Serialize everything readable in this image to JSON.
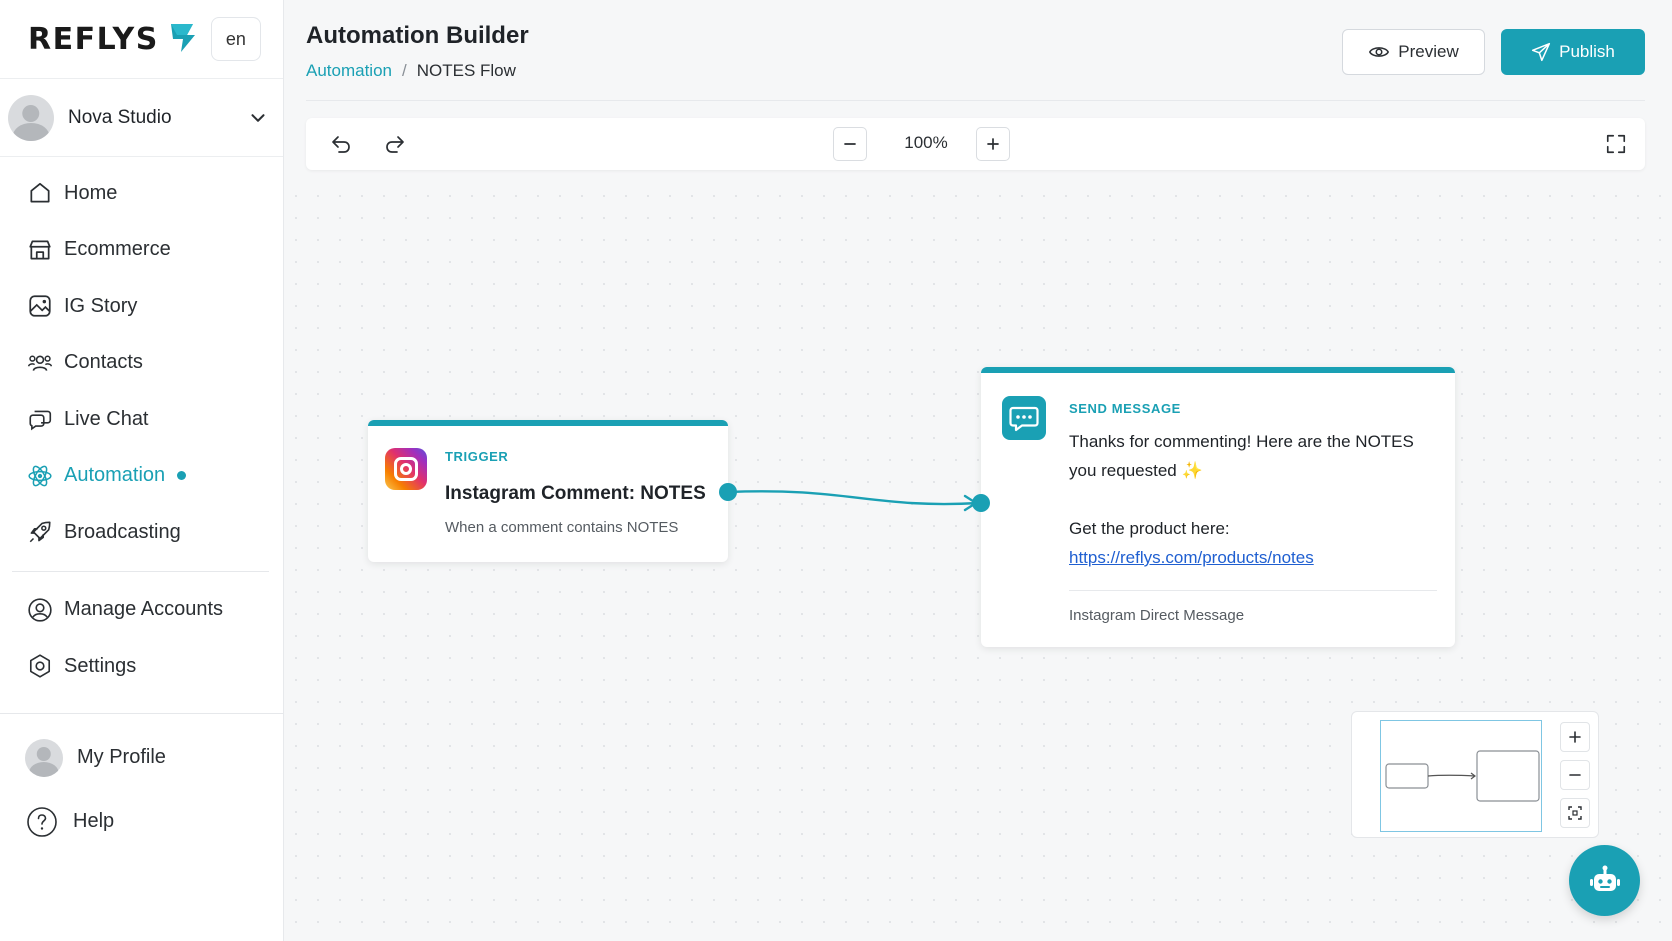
{
  "brand": {
    "logo_text": "REFLYS",
    "lang": "en"
  },
  "workspace": {
    "name": "Nova Studio"
  },
  "nav": {
    "items": [
      {
        "label": "Home",
        "icon": "home-icon"
      },
      {
        "label": "Ecommerce",
        "icon": "store-icon"
      },
      {
        "label": "IG Story",
        "icon": "story-icon"
      },
      {
        "label": "Contacts",
        "icon": "contacts-icon"
      },
      {
        "label": "Live Chat",
        "icon": "chat-icon"
      },
      {
        "label": "Automation",
        "icon": "automation-icon",
        "active": true
      },
      {
        "label": "Broadcasting",
        "icon": "rocket-icon"
      }
    ],
    "secondary": [
      {
        "label": "Manage Accounts",
        "icon": "user-circle-icon"
      },
      {
        "label": "Settings",
        "icon": "settings-icon"
      }
    ],
    "profile": "My Profile",
    "help": "Help"
  },
  "header": {
    "title": "Automation Builder",
    "breadcrumb_parent": "Automation",
    "breadcrumb_sep": "/",
    "breadcrumb_current": "NOTES Flow",
    "preview_label": "Preview",
    "publish_label": "Publish"
  },
  "toolbar": {
    "zoom": "100%"
  },
  "flow": {
    "trigger": {
      "label": "TRIGGER",
      "title": "Instagram Comment: NOTES",
      "description": "When a comment contains NOTES"
    },
    "send": {
      "label": "SEND MESSAGE",
      "text": "Thanks for commenting! Here are the NOTES you requested ✨",
      "line2": "Get the product here:",
      "link": "https://reflys.com/products/notes",
      "footer": "Instagram Direct Message"
    }
  },
  "colors": {
    "accent": "#1aa0b4",
    "link": "#1f5fd1"
  }
}
